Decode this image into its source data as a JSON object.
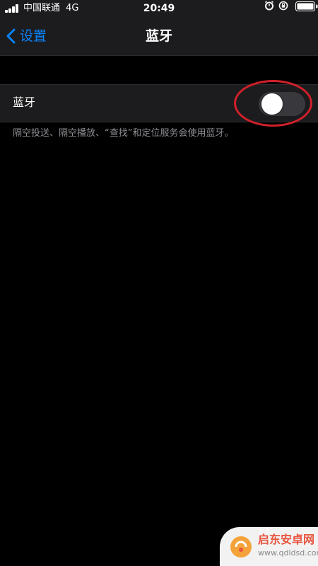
{
  "status_bar": {
    "carrier": "中国联通",
    "network": "4G",
    "time": "20:49",
    "icons": [
      "signal-icon",
      "alarm-icon",
      "rotation-lock-icon",
      "battery-icon"
    ]
  },
  "nav": {
    "back_label": "设置",
    "title": "蓝牙"
  },
  "bluetooth_row": {
    "label": "蓝牙",
    "toggle_state": "off"
  },
  "footnote": "隔空投送、隔空播放、“查找”和定位服务会使用蓝牙。",
  "watermark": {
    "title": "启东安卓网",
    "url": "www.qdldsd.com"
  },
  "colors": {
    "accent": "#0a84ff",
    "background": "#000000",
    "panel": "#1c1c1e",
    "highlight": "#d0202a",
    "toggle_off": "#39393d"
  }
}
